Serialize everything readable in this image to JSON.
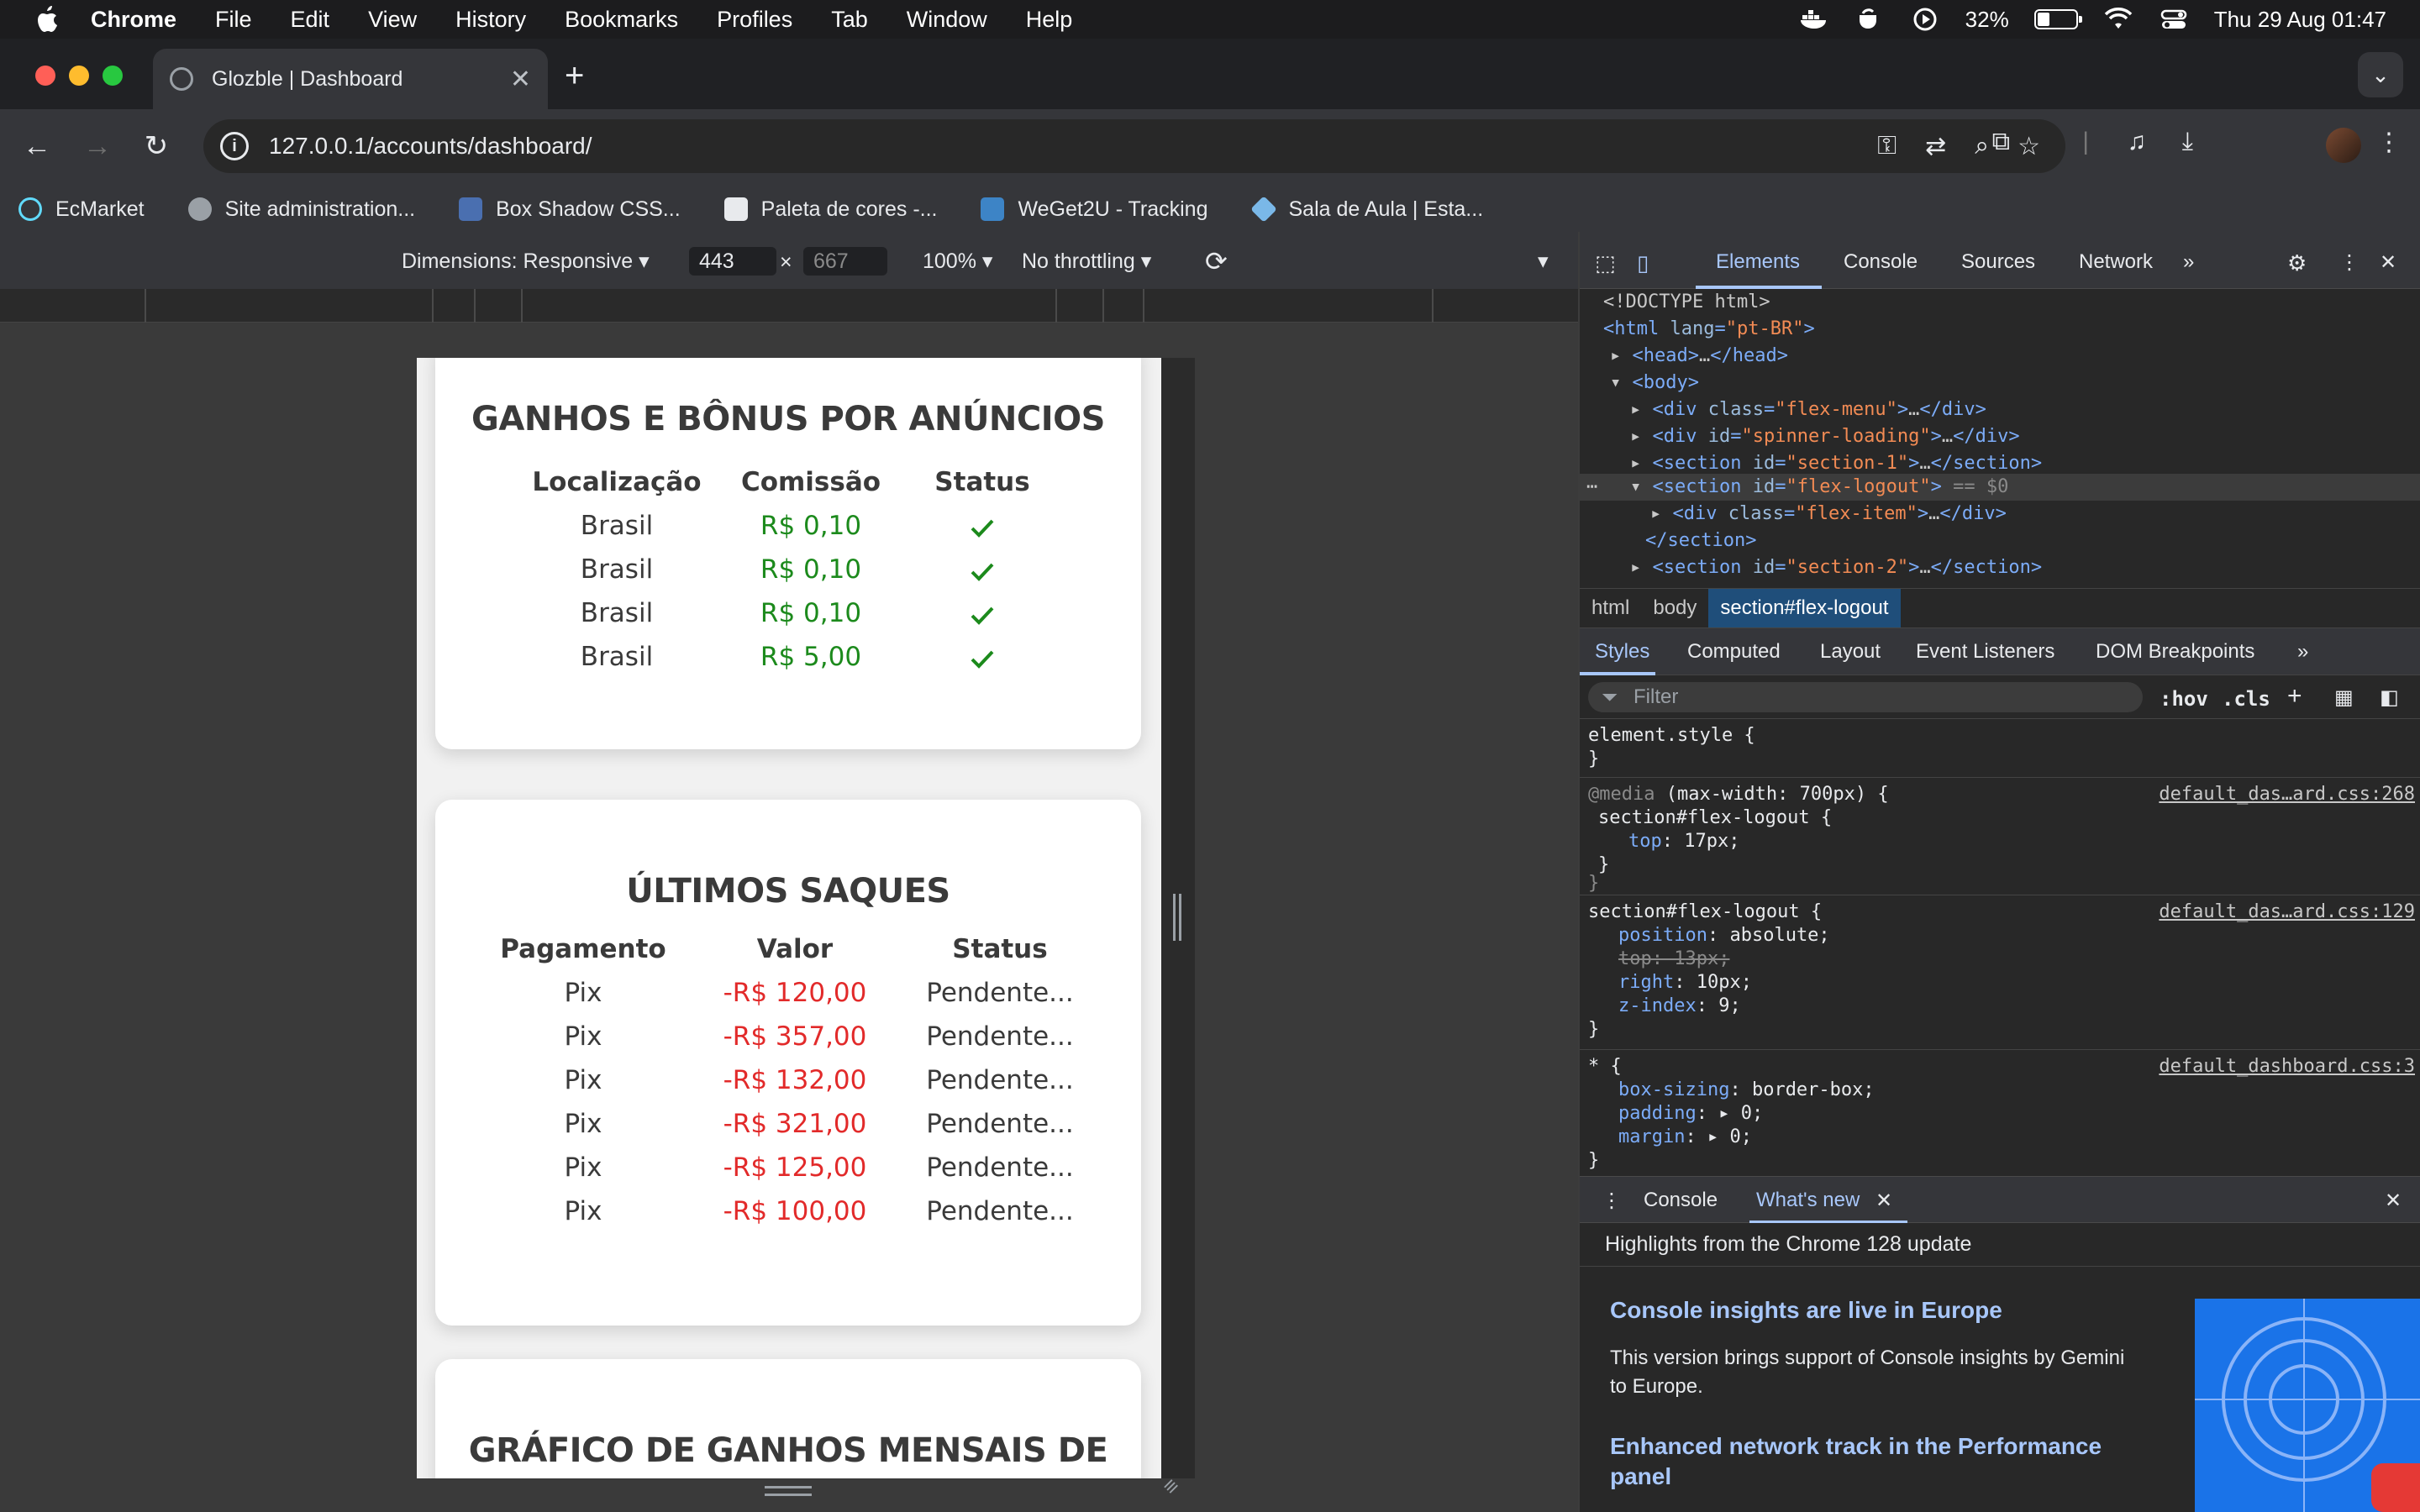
{
  "menubar": {
    "app": "Chrome",
    "items": [
      "File",
      "Edit",
      "View",
      "History",
      "Bookmarks",
      "Profiles",
      "Tab",
      "Window",
      "Help"
    ],
    "battery": "32%",
    "battery_level": 0.32,
    "clock": "Thu 29 Aug  01:47"
  },
  "tab": {
    "title": "Glozble | Dashboard"
  },
  "omnibox": {
    "url": "127.0.0.1/accounts/dashboard/"
  },
  "bookmarks": [
    "EcMarket",
    "Site administration...",
    "Box Shadow CSS...",
    "Paleta de cores -...",
    "WeGet2U - Tracking",
    "Sala de Aula | Esta..."
  ],
  "device_toolbar": {
    "dimensions": "Dimensions: Responsive",
    "width": "443",
    "height": "667",
    "zoom": "100%",
    "throttling": "No throttling"
  },
  "page": {
    "ganhos": {
      "title": "GANHOS E BÔNUS POR ANÚNCIOS",
      "headers": [
        "Localização",
        "Comissão",
        "Status"
      ],
      "rows": [
        {
          "local": "Brasil",
          "comissao": "R$ 0,10"
        },
        {
          "local": "Brasil",
          "comissao": "R$ 0,10"
        },
        {
          "local": "Brasil",
          "comissao": "R$ 0,10"
        },
        {
          "local": "Brasil",
          "comissao": "R$ 5,00"
        }
      ]
    },
    "saques": {
      "title": "ÚLTIMOS SAQUES",
      "headers": [
        "Pagamento",
        "Valor",
        "Status"
      ],
      "rows": [
        {
          "pagamento": "Pix",
          "valor": "-R$ 120,00",
          "status": "Pendente..."
        },
        {
          "pagamento": "Pix",
          "valor": "-R$ 357,00",
          "status": "Pendente..."
        },
        {
          "pagamento": "Pix",
          "valor": "-R$ 132,00",
          "status": "Pendente..."
        },
        {
          "pagamento": "Pix",
          "valor": "-R$ 321,00",
          "status": "Pendente..."
        },
        {
          "pagamento": "Pix",
          "valor": "-R$ 125,00",
          "status": "Pendente..."
        },
        {
          "pagamento": "Pix",
          "valor": "-R$ 100,00",
          "status": "Pendente..."
        }
      ]
    },
    "grafico": {
      "title": "GRÁFICO DE GANHOS MENSAIS DE"
    }
  },
  "devtools": {
    "tabs": [
      "Elements",
      "Console",
      "Sources",
      "Network"
    ],
    "dom": {
      "doctype": "<!DOCTYPE html>",
      "html_open": "<html ",
      "html_attr": "lang",
      "html_val": "\"pt-BR\"",
      "head": "<head>",
      "head_close": "</head>",
      "body": "<body>",
      "div_open": "<div ",
      "div_close": "</div>",
      "section_open": "<section ",
      "section_close": "</section>",
      "attr_class": "class",
      "attr_id": "id",
      "l1_val": "\"flex-menu\"",
      "l2_val": "\"spinner-loading\"",
      "l3_val": "\"section-1\"",
      "l4_val": "\"flex-logout\"",
      "l4_suffix": " == $0",
      "l5_val": "\"flex-item\"",
      "l7_val": "\"section-2\""
    },
    "breadcrumbs": [
      "html",
      "body",
      "section#flex-logout"
    ],
    "styles_tabs": [
      "Styles",
      "Computed",
      "Layout",
      "Event Listeners",
      "DOM Breakpoints"
    ],
    "filter_placeholder": "Filter",
    "filter_tools": [
      ":hov",
      ".cls"
    ],
    "styles": {
      "element_style": "element.style {",
      "close_brace": "}",
      "media": "@media ",
      "media_cond": "(max-width: 700px) {",
      "rule1_selector": "section#flex-logout {",
      "rule1_src": "default_das…ard.css:268",
      "top": "top",
      "top_val": "17px;",
      "rule2_src": "default_das…ard.css:129",
      "position": "position",
      "position_val": "absolute;",
      "top_old": "top: 13px;",
      "right": "right",
      "right_val": "10px;",
      "zindex": "z-index",
      "zindex_val": "9;",
      "rule3_selector": "* {",
      "rule3_src": "default_dashboard.css:3",
      "boxsizing": "box-sizing",
      "boxsizing_val": "border-box;",
      "padding": "padding",
      "padding_val": "0;",
      "margin": "margin",
      "margin_val": "0;"
    },
    "drawer_tabs": [
      "Console",
      "What's new"
    ],
    "whats_new": {
      "heading": "Highlights from the Chrome 128 update",
      "item1_title": "Console insights are live in Europe",
      "item1_body": "This version brings support of Console insights by Gemini to Europe.",
      "item2_title": "Enhanced network track in the Performance panel"
    }
  }
}
